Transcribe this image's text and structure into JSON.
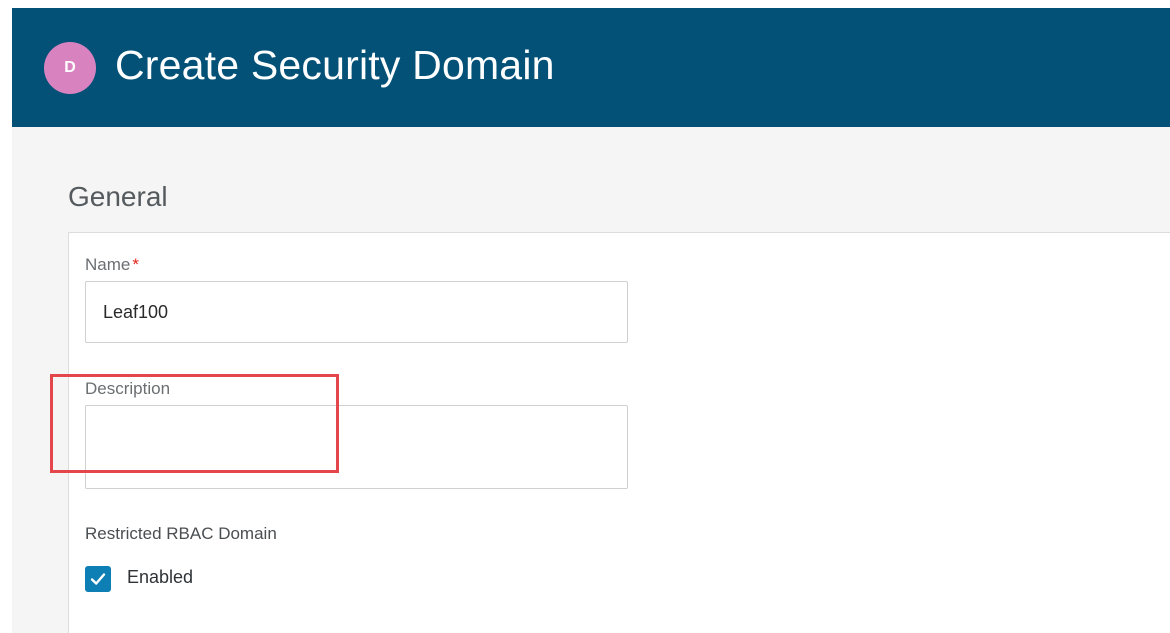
{
  "header": {
    "avatar_letter": "D",
    "title": "Create Security Domain",
    "background_color": "#035177",
    "avatar_color": "#d982c0"
  },
  "general": {
    "section_title": "General",
    "name_field": {
      "label": "Name",
      "required_marker": "*",
      "value": "Leaf100"
    },
    "description_field": {
      "label": "Description",
      "value": ""
    },
    "restricted_rbac": {
      "label": "Restricted RBAC Domain",
      "checkbox_label": "Enabled",
      "checked": true,
      "checkbox_color": "#0d7fb4",
      "highlight_color": "#e3474c"
    }
  },
  "icons": {
    "checkbox_check": "checkmark-icon"
  }
}
